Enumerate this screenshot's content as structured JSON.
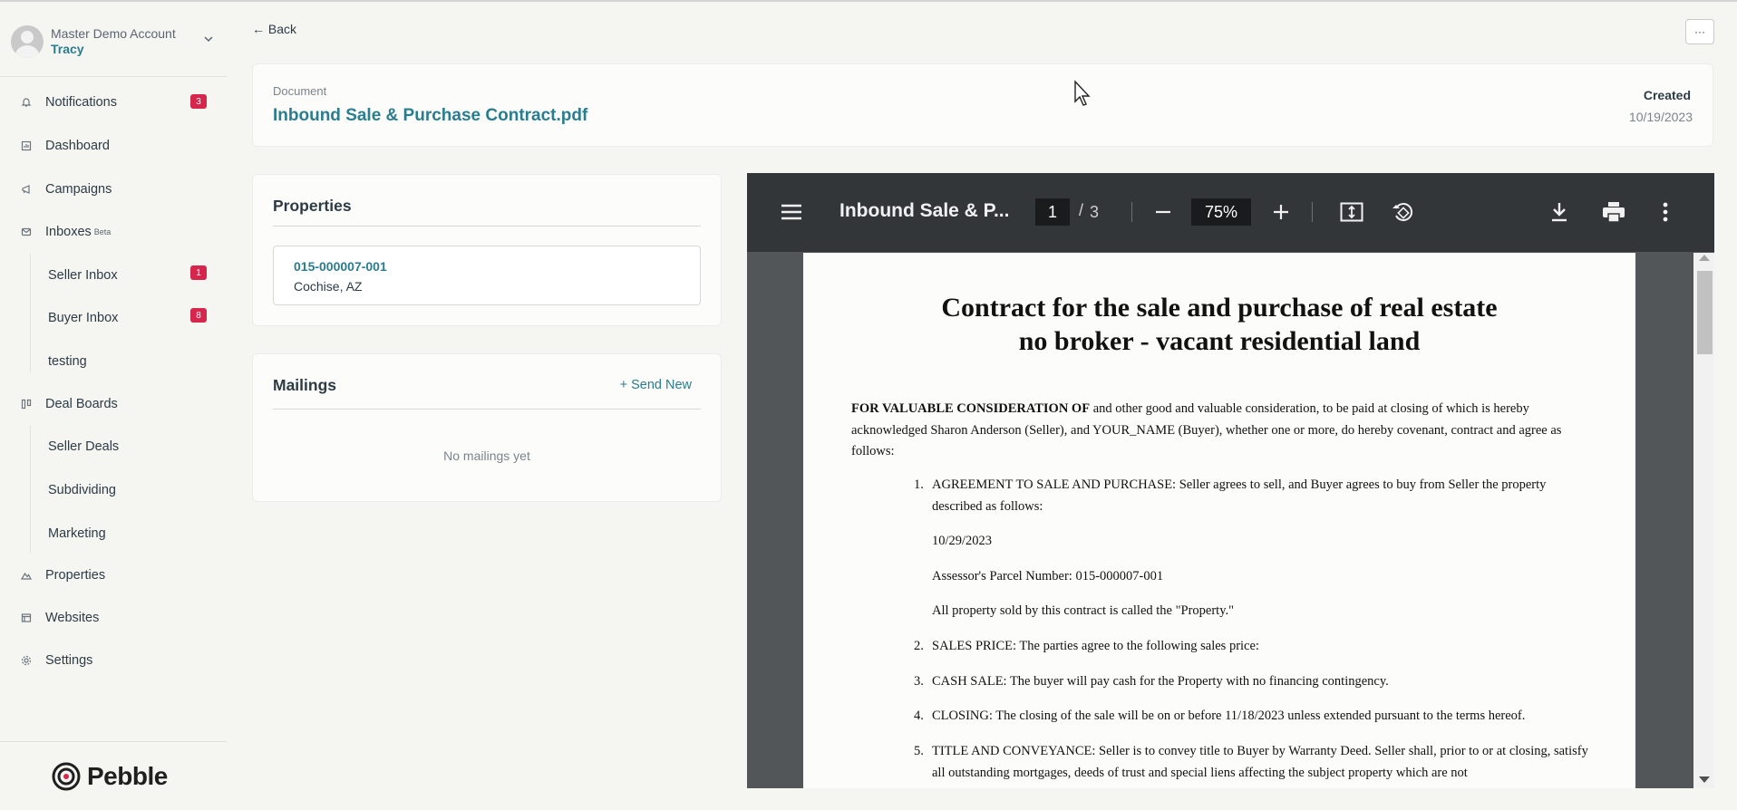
{
  "account": {
    "name": "Master Demo Account",
    "user": "Tracy"
  },
  "nav": {
    "notifications": {
      "label": "Notifications",
      "badge": "3"
    },
    "dashboard": "Dashboard",
    "campaigns": "Campaigns",
    "inboxes": {
      "label": "Inboxes",
      "beta": "Beta"
    },
    "seller_inbox": {
      "label": "Seller Inbox",
      "badge": "1"
    },
    "buyer_inbox": {
      "label": "Buyer Inbox",
      "badge": "8"
    },
    "testing": "testing",
    "deal_boards": "Deal Boards",
    "seller_deals": "Seller Deals",
    "subdividing": "Subdividing",
    "marketing": "Marketing",
    "properties": "Properties",
    "websites": "Websites",
    "settings": "Settings"
  },
  "brand": "Pebble",
  "back": "Back",
  "more": "···",
  "document": {
    "label": "Document",
    "title": "Inbound Sale & Purchase Contract.pdf",
    "created_label": "Created",
    "created_date": "10/19/2023"
  },
  "properties_card": {
    "title": "Properties",
    "items": [
      {
        "id": "015-000007-001",
        "location": "Cochise, AZ"
      }
    ]
  },
  "mailings_card": {
    "title": "Mailings",
    "send_new": "Send New",
    "empty": "No mailings yet"
  },
  "pdf": {
    "title": "Inbound Sale & P...",
    "page": "1",
    "page_sep": "/",
    "total_pages": "3",
    "zoom": "75%",
    "heading_line1": "Contract for the sale and purchase of real estate",
    "heading_line2": "no broker - vacant residential land",
    "intro_bold": "FOR VALUABLE CONSIDERATION OF",
    "intro_rest": " and other good and valuable consideration, to be paid at closing of which is hereby acknowledged Sharon Anderson (Seller), and YOUR_NAME (Buyer), whether one or more, do hereby covenant, contract and agree as follows:",
    "items": [
      {
        "num": "1.",
        "text": "AGREEMENT TO SALE AND PURCHASE: Seller agrees to sell, and Buyer agrees to buy from Seller the property described as follows:"
      },
      {
        "num": "",
        "text": "10/29/2023"
      },
      {
        "num": "",
        "text": "Assessor's Parcel Number: 015-000007-001"
      },
      {
        "num": "",
        "text": "All property sold by this contract is called the \"Property.\""
      },
      {
        "num": "2.",
        "text": "SALES PRICE: The parties agree to the following sales price:"
      },
      {
        "num": "3.",
        "text": "CASH SALE: The buyer will pay cash for the Property with no financing contingency."
      },
      {
        "num": "4.",
        "text": "CLOSING: The closing of the sale will be on or before 11/18/2023 unless extended pursuant to the terms hereof."
      },
      {
        "num": "5.",
        "text": "TITLE AND CONVEYANCE: Seller is to convey title to Buyer by Warranty Deed. Seller shall, prior to or at closing, satisfy all outstanding mortgages, deeds of trust and special liens affecting the subject property which are not"
      }
    ]
  },
  "colors": {
    "accent": "#2a7d8f",
    "badge": "#d7264c",
    "pdf_toolbar": "#323639",
    "pdf_bg": "#525659"
  }
}
